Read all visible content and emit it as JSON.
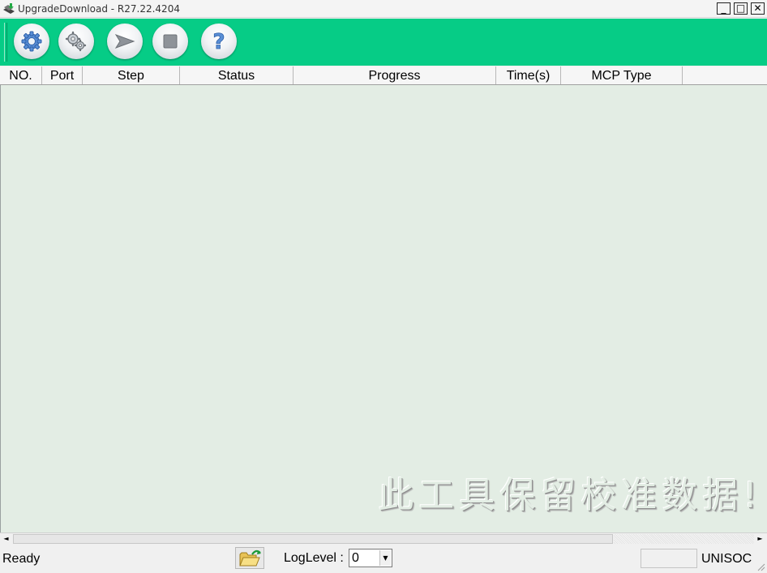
{
  "window": {
    "title": "UpgradeDownload - R27.22.4204",
    "minimize": "_",
    "maximize": "□",
    "close": "✕"
  },
  "toolbar": {
    "color": "#06cc86",
    "buttons": [
      {
        "name": "settings-gear-icon"
      },
      {
        "name": "gears-icon"
      },
      {
        "name": "start-arrow-icon"
      },
      {
        "name": "stop-square-icon"
      },
      {
        "name": "help-question-icon",
        "glyph": "?"
      }
    ]
  },
  "list": {
    "columns": [
      "NO.",
      "Port",
      "Step",
      "Status",
      "Progress",
      "Time(s)",
      "MCP Type"
    ],
    "background": "#e3ede4",
    "watermark": "此工具保留校准数据!"
  },
  "scrollbar": {
    "left_arrow": "◄",
    "right_arrow": "►"
  },
  "statusbar": {
    "status": "Ready",
    "loglevel_label": "LogLevel :",
    "loglevel_value": "0",
    "dropdown_arrow": "▼",
    "vendor": "UNISOC"
  }
}
